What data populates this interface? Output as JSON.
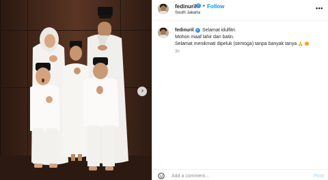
{
  "post": {
    "username": "fedinuril",
    "verified_icon": "verified-badge-icon",
    "separator": "•",
    "follow_label": "Follow",
    "location": "South Jakarta",
    "more_icon": "more-options-icon",
    "more_glyph": "•••"
  },
  "caption": {
    "username": "fedinuril",
    "line1": "Selamat idulfitri.",
    "line2": "Mohon maaf lahir dan batin.",
    "line3": "Selamat menikmati dipeluk (semoga) tanpa banyak tanya",
    "emoji_hands": "🙏",
    "time": "3h"
  },
  "photo": {
    "next_glyph": "›"
  },
  "comment": {
    "placeholder": "Add a comment...",
    "post_label": "Post"
  },
  "colors": {
    "link_blue": "#0095f6",
    "post_disabled": "#b2dffc",
    "verified_blue": "#3897f0",
    "text": "#262626",
    "muted": "#8e8e8e"
  }
}
